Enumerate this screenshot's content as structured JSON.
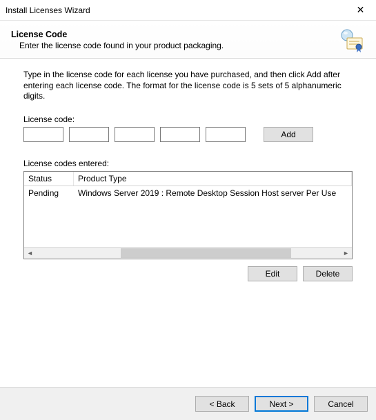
{
  "window": {
    "title": "Install Licenses Wizard"
  },
  "header": {
    "title": "License Code",
    "subtitle": "Enter the license code found in your product packaging."
  },
  "body": {
    "instructions": "Type in the license code for each license you have purchased, and then click Add after entering each license code. The format for the license code is 5 sets of 5 alphanumeric digits.",
    "license_code_label": "License code:",
    "code_values": [
      "",
      "",
      "",
      "",
      ""
    ],
    "add_label": "Add",
    "entered_label": "License codes entered:",
    "columns": {
      "status": "Status",
      "type": "Product Type"
    },
    "rows": [
      {
        "status": "Pending",
        "type": "Windows Server 2019 : Remote Desktop Session Host server Per Use"
      }
    ],
    "edit_label": "Edit",
    "delete_label": "Delete"
  },
  "footer": {
    "back": "< Back",
    "next": "Next >",
    "cancel": "Cancel"
  }
}
